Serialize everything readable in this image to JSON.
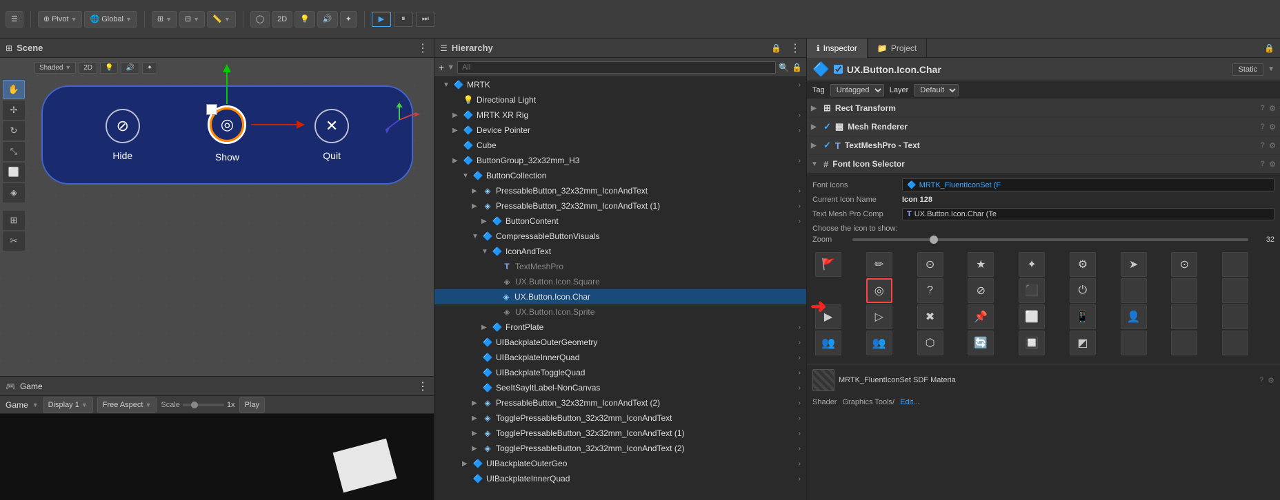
{
  "scene": {
    "title": "Scene",
    "buttons": [
      {
        "label": "Hide",
        "icon": "⊘"
      },
      {
        "label": "Show",
        "icon": "◎",
        "selected": true
      },
      {
        "label": "Quit",
        "icon": "✕"
      }
    ]
  },
  "toolbar": {
    "pivot_label": "Pivot",
    "global_label": "Global",
    "2d_label": "2D",
    "play_label": "Play",
    "pause_label": "Pause",
    "step_label": "Step"
  },
  "game": {
    "title": "Game",
    "display_label": "Display 1",
    "aspect_label": "Free Aspect",
    "scale_label": "Scale",
    "scale_value": "1x",
    "play_btn": "Play"
  },
  "hierarchy": {
    "title": "Hierarchy",
    "search_placeholder": "All",
    "items": [
      {
        "label": "MRTK",
        "indent": 0,
        "arrow": "▼",
        "icon": "🔷",
        "type": "root"
      },
      {
        "label": "Directional Light",
        "indent": 1,
        "arrow": "",
        "icon": "💡",
        "type": "light"
      },
      {
        "label": "MRTK XR Rig",
        "indent": 1,
        "arrow": "▶",
        "icon": "🔷",
        "type": "cube"
      },
      {
        "label": "Device Pointer",
        "indent": 1,
        "arrow": "▶",
        "icon": "🔷",
        "type": "cube"
      },
      {
        "label": "Cube",
        "indent": 1,
        "arrow": "",
        "icon": "🔷",
        "type": "cube"
      },
      {
        "label": "ButtonGroup_32x32mm_H3",
        "indent": 1,
        "arrow": "▶",
        "icon": "🔷",
        "type": "cube"
      },
      {
        "label": "ButtonCollection",
        "indent": 2,
        "arrow": "▼",
        "icon": "🔷",
        "type": "cube"
      },
      {
        "label": "PressableButton_32x32mm_IconAndText",
        "indent": 3,
        "arrow": "▶",
        "icon": "◈",
        "type": "mesh"
      },
      {
        "label": "PressableButton_32x32mm_IconAndText (1)",
        "indent": 3,
        "arrow": "▶",
        "icon": "◈",
        "type": "mesh"
      },
      {
        "label": "ButtonContent",
        "indent": 4,
        "arrow": "▶",
        "icon": "🔷",
        "type": "cube"
      },
      {
        "label": "CompressableButtonVisuals",
        "indent": 3,
        "arrow": "▼",
        "icon": "🔷",
        "type": "cube"
      },
      {
        "label": "IconAndText",
        "indent": 4,
        "arrow": "▼",
        "icon": "🔷",
        "type": "cube"
      },
      {
        "label": "TextMeshPro",
        "indent": 5,
        "arrow": "",
        "icon": "T",
        "type": "text",
        "grayed": true
      },
      {
        "label": "UX.Button.Icon.Square",
        "indent": 5,
        "arrow": "",
        "icon": "◈",
        "type": "mesh",
        "grayed": true
      },
      {
        "label": "UX.Button.Icon.Char",
        "indent": 5,
        "arrow": "",
        "icon": "◈",
        "type": "mesh",
        "selected": true
      },
      {
        "label": "UX.Button.Icon.Sprite",
        "indent": 5,
        "arrow": "",
        "icon": "◈",
        "type": "mesh",
        "grayed": true
      },
      {
        "label": "FrontPlate",
        "indent": 4,
        "arrow": "▶",
        "icon": "🔷",
        "type": "cube"
      },
      {
        "label": "UIBackplateOuterGeometry",
        "indent": 3,
        "arrow": "",
        "icon": "🔷",
        "type": "cube"
      },
      {
        "label": "UIBackplateInnerQuad",
        "indent": 3,
        "arrow": "",
        "icon": "🔷",
        "type": "cube"
      },
      {
        "label": "UIBackplateToggleQuad",
        "indent": 3,
        "arrow": "",
        "icon": "🔷",
        "type": "cube"
      },
      {
        "label": "SeeItSayItLabel-NonCanvas",
        "indent": 3,
        "arrow": "",
        "icon": "🔷",
        "type": "cube"
      },
      {
        "label": "PressableButton_32x32mm_IconAndText (2)",
        "indent": 3,
        "arrow": "▶",
        "icon": "◈",
        "type": "mesh"
      },
      {
        "label": "TogglePressableButton_32x32mm_IconAndText",
        "indent": 3,
        "arrow": "▶",
        "icon": "◈",
        "type": "mesh"
      },
      {
        "label": "TogglePressableButton_32x32mm_IconAndText (1)",
        "indent": 3,
        "arrow": "▶",
        "icon": "◈",
        "type": "mesh"
      },
      {
        "label": "TogglePressableButton_32x32mm_IconAndText (2)",
        "indent": 3,
        "arrow": "▶",
        "icon": "◈",
        "type": "mesh"
      },
      {
        "label": "UIBackplateOuterGeo",
        "indent": 2,
        "arrow": "▶",
        "icon": "🔷",
        "type": "cube"
      },
      {
        "label": "UIBackplateInnerQuad",
        "indent": 2,
        "arrow": "",
        "icon": "🔷",
        "type": "cube"
      }
    ]
  },
  "inspector": {
    "title": "Inspector",
    "project_label": "Project",
    "component_name": "UX.Button.Icon.Char",
    "static_label": "Static",
    "tag_label": "Tag",
    "tag_value": "Untagged",
    "layer_label": "Layer",
    "layer_value": "Default",
    "sections": [
      {
        "name": "Rect Transform",
        "checked": true,
        "icon": "⊞"
      },
      {
        "name": "Mesh Renderer",
        "checked": true,
        "icon": "▦"
      },
      {
        "name": "TextMeshPro - Text",
        "checked": true,
        "icon": "T"
      },
      {
        "name": "Font Icon Selector",
        "checked": false,
        "icon": "#"
      }
    ],
    "font_icons": {
      "label": "Font Icons",
      "value": "MRTK_FluentIconSet (F"
    },
    "current_icon": {
      "label": "Current Icon Name",
      "value": "Icon 128"
    },
    "text_mesh": {
      "label": "Text Mesh Pro Comp",
      "value": "UX.Button.Icon.Char (Te",
      "prefix": "T"
    },
    "choose_label": "Choose the icon to show:",
    "zoom": {
      "label": "Zoom",
      "value": 32
    },
    "icons": [
      {
        "symbol": "🚩",
        "selected": false
      },
      {
        "symbol": "✏",
        "selected": false
      },
      {
        "symbol": "⊙",
        "selected": false
      },
      {
        "symbol": "★",
        "selected": false
      },
      {
        "symbol": "✦",
        "selected": false
      },
      {
        "symbol": "⚙",
        "selected": false
      },
      {
        "symbol": "➤",
        "selected": false
      },
      {
        "symbol": "⊙",
        "selected": false
      },
      {
        "symbol": "◎",
        "selected": true
      },
      {
        "symbol": "?",
        "selected": false
      },
      {
        "symbol": "⊘",
        "selected": false
      },
      {
        "symbol": "⬛",
        "selected": false
      },
      {
        "symbol": "⏻",
        "selected": false
      },
      {
        "symbol": "▶",
        "selected": false
      },
      {
        "symbol": "▷",
        "selected": false
      },
      {
        "symbol": "✖",
        "selected": false
      },
      {
        "symbol": "📌",
        "selected": false
      },
      {
        "symbol": "⬜",
        "selected": false
      },
      {
        "symbol": "📱",
        "selected": false
      },
      {
        "symbol": "👤",
        "selected": false
      },
      {
        "symbol": "👥",
        "selected": false
      },
      {
        "symbol": "👥",
        "selected": false
      },
      {
        "symbol": "⬡",
        "selected": false
      },
      {
        "symbol": "🔄",
        "selected": false
      },
      {
        "symbol": "🔲",
        "selected": false
      },
      {
        "symbol": "◩",
        "selected": false
      }
    ],
    "material": {
      "name": "MRTK_FluentIconSet SDF Materia",
      "shader_label": "Shader",
      "shader_value": "Graphics Tools/",
      "edit_label": "Edit..."
    }
  }
}
